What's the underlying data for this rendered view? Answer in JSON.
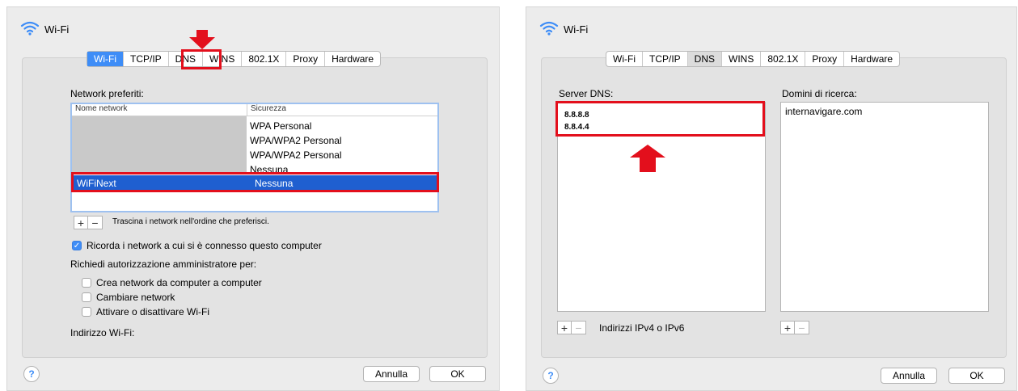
{
  "left": {
    "title": "Wi-Fi",
    "tabs": [
      "Wi-Fi",
      "TCP/IP",
      "DNS",
      "WINS",
      "802.1X",
      "Proxy",
      "Hardware"
    ],
    "preferred_label": "Network preferiti:",
    "columns": [
      "Nome network",
      "Sicurezza"
    ],
    "rows": [
      {
        "name": "",
        "security": "WPA Personal"
      },
      {
        "name": "",
        "security": "WPA/WPA2 Personal"
      },
      {
        "name": "",
        "security": "WPA/WPA2 Personal"
      },
      {
        "name": "",
        "security": "Nessuna"
      },
      {
        "name": "WiFiNext",
        "security": "Nessuna"
      }
    ],
    "drag_hint": "Trascina i network nell'ordine che preferisci.",
    "remember_label": "Ricorda i network a cui si è connesso questo computer",
    "admin_label": "Richiedi autorizzazione amministratore per:",
    "admin_options": [
      "Crea network da computer a computer",
      "Cambiare network",
      "Attivare o disattivare Wi-Fi"
    ],
    "address_label": "Indirizzo Wi-Fi:",
    "cancel": "Annulla",
    "ok": "OK",
    "plus": "+",
    "minus": "−",
    "help": "?"
  },
  "right": {
    "title": "Wi-Fi",
    "tabs": [
      "Wi-Fi",
      "TCP/IP",
      "DNS",
      "WINS",
      "802.1X",
      "Proxy",
      "Hardware"
    ],
    "dns_label": "Server DNS:",
    "dns_servers": [
      "8.8.8.8",
      "8.8.4.4"
    ],
    "search_label": "Domini di ricerca:",
    "search_domains": [
      "internavigare.com"
    ],
    "ip_hint": "Indirizzi IPv4 o IPv6",
    "cancel": "Annulla",
    "ok": "OK",
    "plus": "+",
    "minus": "−",
    "help": "?"
  },
  "colors": {
    "accent": "#3e8df7",
    "selection": "#1f5fd0",
    "annotation_red": "#e30f1c"
  },
  "icons": [
    "wifi-icon",
    "down-arrow-annotation",
    "up-arrow-annotation",
    "checkmark-icon",
    "help-icon"
  ]
}
